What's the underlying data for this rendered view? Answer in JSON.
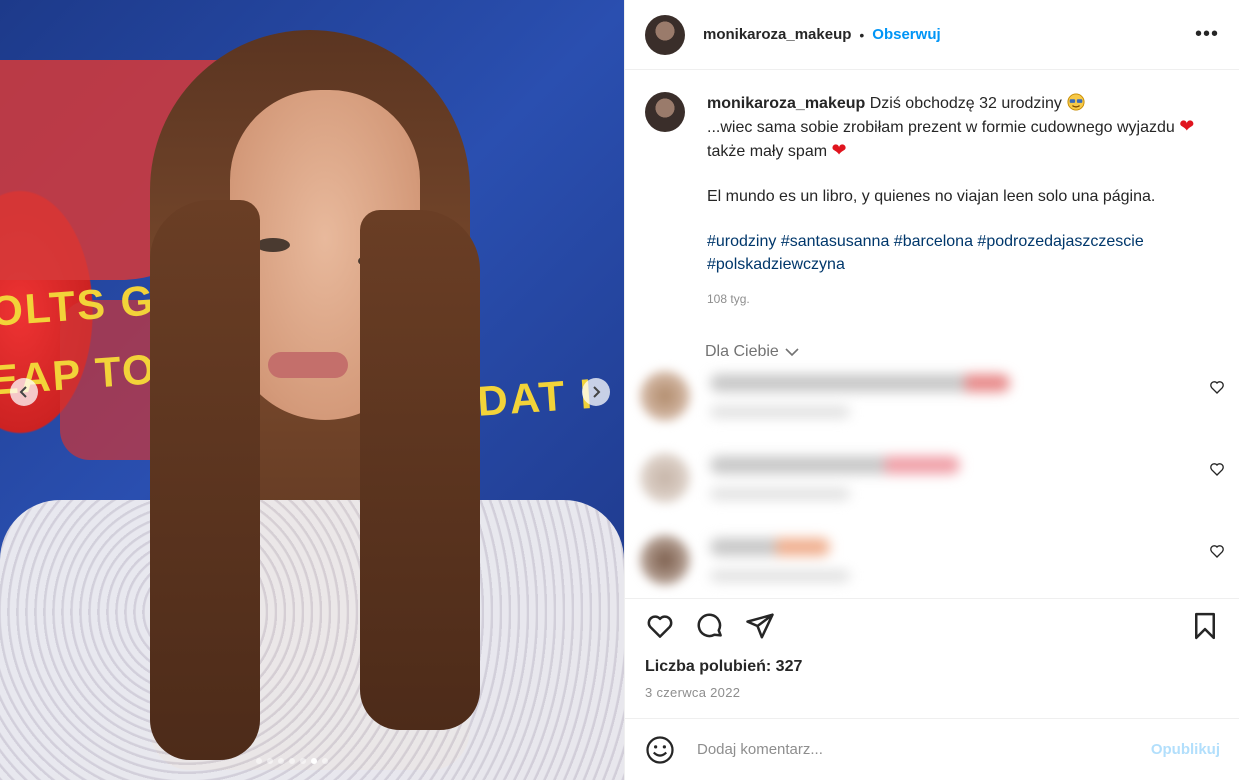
{
  "media": {
    "banner_texts": [
      "OLTS GOL",
      "EAP TOT",
      "NDAT I"
    ],
    "carousel": {
      "total": 7,
      "active": 5
    }
  },
  "header": {
    "username": "monikaroza_makeup",
    "separator": "•",
    "follow_label": "Obserwuj",
    "more_label": "•••"
  },
  "caption": {
    "username": "monikaroza_makeup",
    "line1": "Dziś obchodzę 32 urodziny",
    "line2a": "...wiec sama sobie zrobiłam prezent w formie cudownego wyjazdu",
    "line2b": "także mały spam",
    "quote": "El mundo es un libro, y quienes no viajan leen solo una página.",
    "hashtags1": "#urodziny #santasusanna #barcelona #podrozedajaszczescie",
    "hashtags2": "#polskadziewczyna",
    "time_ago": "108 tyg."
  },
  "for_you": {
    "label": "Dla Ciebie",
    "chevron": "﹀"
  },
  "comments_blurred": 3,
  "actions": {
    "likes_text": "Liczba polubień: 327",
    "date_text": "3 czerwca 2022"
  },
  "add_comment": {
    "placeholder": "Dodaj komentarz...",
    "publish_label": "Opublikuj"
  },
  "colors": {
    "accent": "#0095f6",
    "hashtag": "#00376b",
    "heart": "#e0141e",
    "muted": "#8e8e8e",
    "publish_disabled": "#b2dffc"
  },
  "icons": [
    "heart-icon",
    "comment-icon",
    "share-icon",
    "bookmark-icon",
    "smile-icon",
    "chevron-left-icon",
    "chevron-right-icon",
    "more-icon"
  ]
}
